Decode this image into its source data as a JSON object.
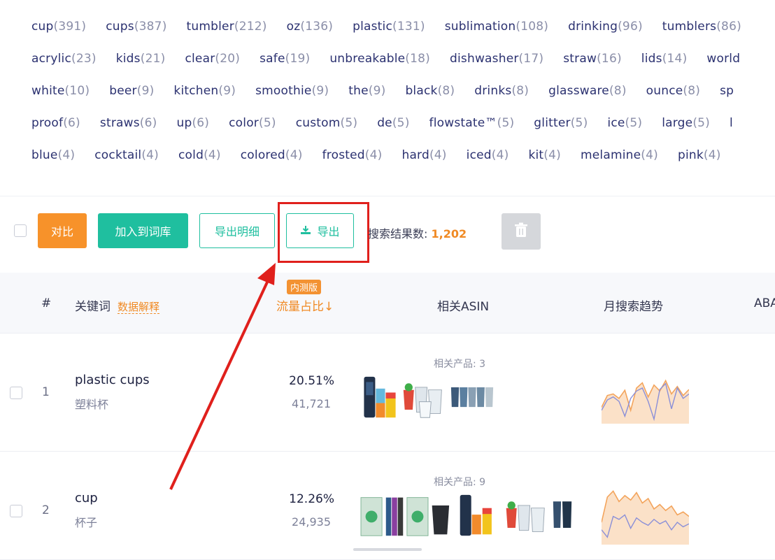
{
  "keyword_tags": [
    [
      {
        "word": "cup",
        "count": "(391)"
      },
      {
        "word": "cups",
        "count": "(387)"
      },
      {
        "word": "tumbler",
        "count": "(212)"
      },
      {
        "word": "oz",
        "count": "(136)"
      },
      {
        "word": "plastic",
        "count": "(131)"
      },
      {
        "word": "sublimation",
        "count": "(108)"
      },
      {
        "word": "drinking",
        "count": "(96)"
      },
      {
        "word": "tumblers",
        "count": "(86)"
      }
    ],
    [
      {
        "word": "acrylic",
        "count": "(23)"
      },
      {
        "word": "kids",
        "count": "(21)"
      },
      {
        "word": "clear",
        "count": "(20)"
      },
      {
        "word": "safe",
        "count": "(19)"
      },
      {
        "word": "unbreakable",
        "count": "(18)"
      },
      {
        "word": "dishwasher",
        "count": "(17)"
      },
      {
        "word": "straw",
        "count": "(16)"
      },
      {
        "word": "lids",
        "count": "(14)"
      },
      {
        "word": "world",
        "count": ""
      }
    ],
    [
      {
        "word": "white",
        "count": "(10)"
      },
      {
        "word": "beer",
        "count": "(9)"
      },
      {
        "word": "kitchen",
        "count": "(9)"
      },
      {
        "word": "smoothie",
        "count": "(9)"
      },
      {
        "word": "the",
        "count": "(9)"
      },
      {
        "word": "black",
        "count": "(8)"
      },
      {
        "word": "drinks",
        "count": "(8)"
      },
      {
        "word": "glassware",
        "count": "(8)"
      },
      {
        "word": "ounce",
        "count": "(8)"
      },
      {
        "word": "sp",
        "count": ""
      }
    ],
    [
      {
        "word": "proof",
        "count": "(6)"
      },
      {
        "word": "straws",
        "count": "(6)"
      },
      {
        "word": "up",
        "count": "(6)"
      },
      {
        "word": "color",
        "count": "(5)"
      },
      {
        "word": "custom",
        "count": "(5)"
      },
      {
        "word": "de",
        "count": "(5)"
      },
      {
        "word": "flowstate™",
        "count": "(5)"
      },
      {
        "word": "glitter",
        "count": "(5)"
      },
      {
        "word": "ice",
        "count": "(5)"
      },
      {
        "word": "large",
        "count": "(5)"
      },
      {
        "word": "l",
        "count": ""
      }
    ],
    [
      {
        "word": "blue",
        "count": "(4)"
      },
      {
        "word": "cocktail",
        "count": "(4)"
      },
      {
        "word": "cold",
        "count": "(4)"
      },
      {
        "word": "colored",
        "count": "(4)"
      },
      {
        "word": "frosted",
        "count": "(4)"
      },
      {
        "word": "hard",
        "count": "(4)"
      },
      {
        "word": "iced",
        "count": "(4)"
      },
      {
        "word": "kit",
        "count": "(4)"
      },
      {
        "word": "melamine",
        "count": "(4)"
      },
      {
        "word": "pink",
        "count": "(4)"
      }
    ]
  ],
  "toolbar": {
    "compare_label": "对比",
    "add_to_lexicon_label": "加入到词库",
    "export_detail_label": "导出明细",
    "export_label": "导出",
    "result_label": "搜索结果数:",
    "result_count": "1,202",
    "download_icon": "download-icon",
    "delete_icon": "trash-icon"
  },
  "table_header": {
    "index": "#",
    "keyword": "关键词",
    "keyword_hint": "数据解释",
    "beta_badge": "内测版",
    "traffic_share": "流量占比↓",
    "related_asin": "相关ASIN",
    "monthly_trend": "月搜索趋势",
    "aba": "ABA"
  },
  "rows": [
    {
      "index": "1",
      "keyword_en": "plastic cups",
      "keyword_cn": "塑料杯",
      "traffic_pct": "20.51%",
      "search_volume": "41,721",
      "related_products": "相关产品: 3",
      "trend_a": [
        22,
        38,
        40,
        34,
        45,
        18,
        48,
        55,
        36,
        52,
        44,
        58,
        40,
        50,
        38,
        46
      ],
      "trend_b": [
        18,
        32,
        36,
        30,
        10,
        34,
        44,
        48,
        30,
        6,
        46,
        54,
        20,
        48,
        34,
        40
      ]
    },
    {
      "index": "2",
      "keyword_en": "cup",
      "keyword_cn": "杯子",
      "traffic_pct": "12.26%",
      "search_volume": "24,935",
      "related_products": "相关产品: 9",
      "trend_a": [
        30,
        64,
        72,
        58,
        66,
        60,
        70,
        56,
        62,
        48,
        54,
        46,
        52,
        40,
        44,
        38
      ],
      "trend_b": [
        20,
        10,
        38,
        34,
        40,
        22,
        36,
        30,
        26,
        34,
        28,
        32,
        20,
        30,
        24,
        28
      ]
    }
  ],
  "colors": {
    "accent_green": "#1fbf9f",
    "accent_orange": "#f7922a",
    "highlight_red": "#e0201c",
    "trend_orange": "#f3a45c",
    "trend_blue": "#8a8fd8"
  }
}
